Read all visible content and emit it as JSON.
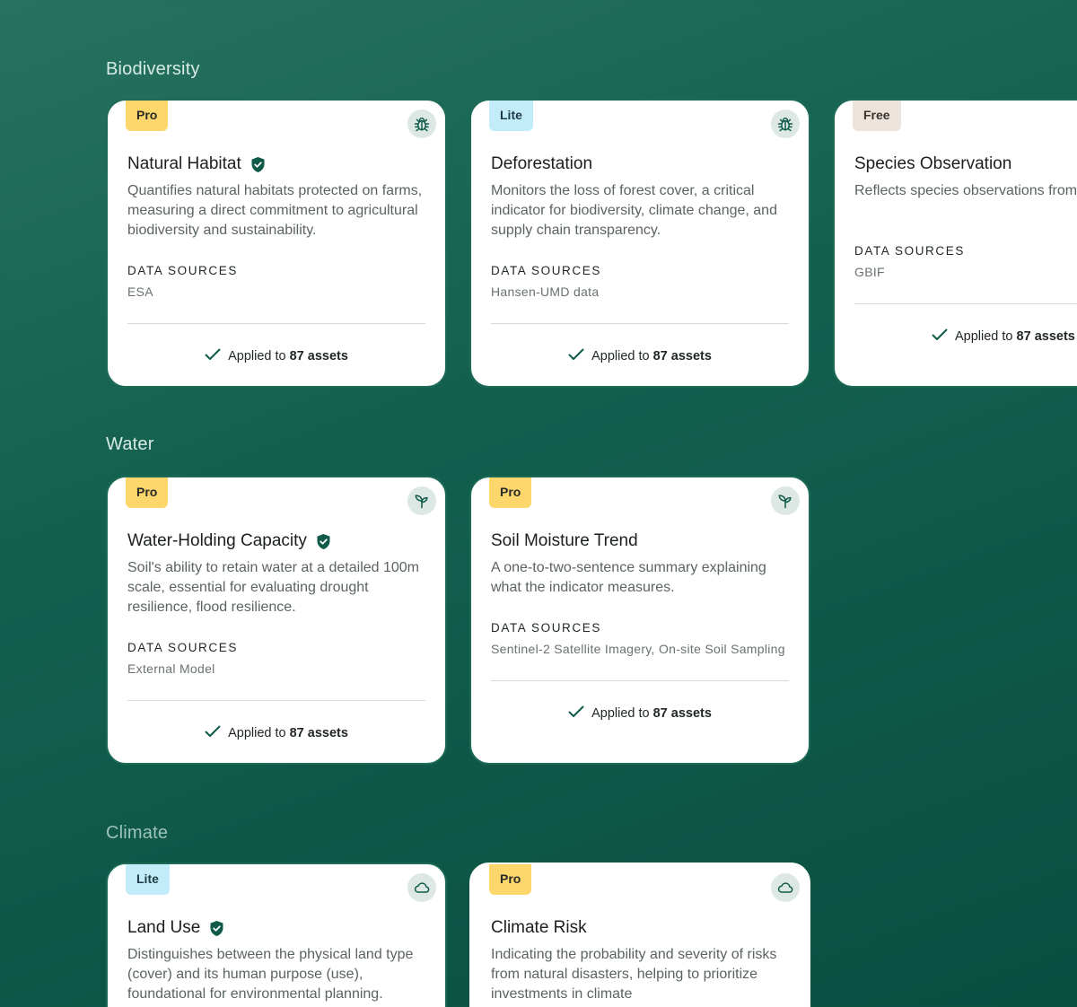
{
  "sections": [
    {
      "title": "Biodiversity",
      "cards": [
        {
          "badge": "Pro",
          "icon": "bug-icon",
          "title": "Natural Habitat",
          "verified": true,
          "description": "Quantifies natural habitats protected on farms, measuring a direct commitment to agricultural biodiversity and sustainability.",
          "data_sources_label": "DATA SOURCES",
          "data_sources": "ESA",
          "applied_prefix": "Applied to",
          "applied_count": "87 assets"
        },
        {
          "badge": "Lite",
          "icon": "bug-icon",
          "title": "Deforestation",
          "verified": false,
          "description": "Monitors the loss of forest cover, a critical indicator for biodiversity, climate change, and supply chain transparency.",
          "data_sources_label": "DATA SOURCES",
          "data_sources": "Hansen-UMD data",
          "applied_prefix": "Applied to",
          "applied_count": "87 assets"
        },
        {
          "badge": "Free",
          "icon": "bug-icon",
          "title": "Species Observation",
          "verified": false,
          "description": "Reflects species observations from data base.",
          "data_sources_label": "DATA SOURCES",
          "data_sources": "GBIF",
          "applied_prefix": "Applied to",
          "applied_count": "87 assets"
        }
      ]
    },
    {
      "title": "Water",
      "cards": [
        {
          "badge": "Pro",
          "icon": "sprout-icon",
          "title": "Water-Holding Capacity",
          "verified": true,
          "description": "Soil's ability to retain water at a detailed 100m scale, essential for evaluating drought resilience, flood resilience.",
          "data_sources_label": "DATA SOURCES",
          "data_sources": "External Model",
          "applied_prefix": "Applied to",
          "applied_count": "87 assets"
        },
        {
          "badge": "Pro",
          "icon": "sprout-icon",
          "title": "Soil Moisture Trend",
          "verified": false,
          "description": "A one-to-two-sentence summary explaining what the indicator measures.",
          "data_sources_label": "DATA SOURCES",
          "data_sources": "Sentinel-2 Satellite Imagery, On-site Soil Sampling",
          "applied_prefix": "Applied to",
          "applied_count": "87 assets"
        }
      ]
    },
    {
      "title": "Climate",
      "cards": [
        {
          "badge": "Lite",
          "icon": "cloud-icon",
          "title": "Land Use",
          "verified": true,
          "description": "Distinguishes between the physical land type (cover) and its human purpose (use), foundational for environmental planning."
        },
        {
          "badge": "Pro",
          "icon": "cloud-icon",
          "title": "Climate Risk",
          "verified": false,
          "description": "Indicating the probability and severity of risks from natural disasters, helping to prioritize investments in climate"
        }
      ]
    }
  ],
  "colors": {
    "pro": "#fdd76b",
    "lite": "#c3ecfb",
    "free": "#ece3dc",
    "accent": "#0f5a49"
  }
}
